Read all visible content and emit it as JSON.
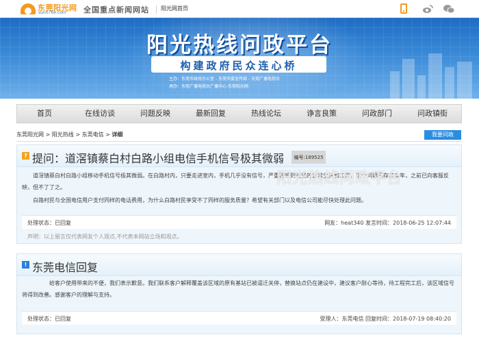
{
  "topbar": {
    "logo_name": "东莞阳光网",
    "logo_domain": "sun0769.com",
    "slogan": "全国重点新闻网站",
    "home_link": "阳光网首页",
    "icons": [
      "mobile-icon",
      "weibo-icon",
      "wechat-icon"
    ]
  },
  "banner": {
    "title": "阳光热线问政平台",
    "subtitle": "构建政府民众连心桥",
    "line1": "主办：东莞市政府办公室 - 东莞市委宣传部 - 东莞广播电视台",
    "line2": "承办：东莞广播电视台广播中心  东莞阳光网"
  },
  "nav": {
    "items": [
      "首页",
      "在线访谈",
      "问题反映",
      "最新回复",
      "热线论坛",
      "诤言良策",
      "问政部门",
      "问政镇街"
    ]
  },
  "breadcrumb": {
    "text": "东莞阳光网 > 阳光热线 > 东莞电信 > ",
    "current": "详细"
  },
  "ask_button": "我要问政",
  "question": {
    "title": "提问：道滘镇蔡白村白路小组电信手机信号极其微弱",
    "id_label": "编号:189525",
    "para1": "道滘镇蔡白村白路小组移动手机信号极其微弱。在白路村内，只要走进室内，手机几乎没有信号，严重影响到村民的日常生活和工作，这个问题已存在多年，之前已向客服反映，但不了了之。",
    "para2": "白路村民与全国电信用户支付同样的电话费用，为什么白路村民享受不了同样的服务质量？希望有关部门以及电信公司能尽快处理此问题。",
    "status": "处理状态：已回复",
    "meta": "网友：heat340 发言时间：2018-06-25 12:07:44",
    "disclaimer": "声明：以上留言仅代表网友个人观点,不代表本网站立场和观点。"
  },
  "reply": {
    "title": "东莞电信回复",
    "para1": "给客户使用带来的不便，我们表示歉意。我们联系客户解释覆盖该区域的原有基站已被逼迁关停，替换站点仍在建设中，建议客户耐心等待，待工程完工后，该区域信号将得到改善。感谢客户的理解与支持。",
    "status": "处理状态：已回复",
    "meta": "受理人：东莞电信 回复时间：2018-07-19 08:40:20"
  },
  "watermark": "阳光热线问政平台",
  "colors": {
    "accent_blue": "#2b8de0",
    "logo_orange": "#f29a1e",
    "panel_bg": "#eef6fc"
  }
}
